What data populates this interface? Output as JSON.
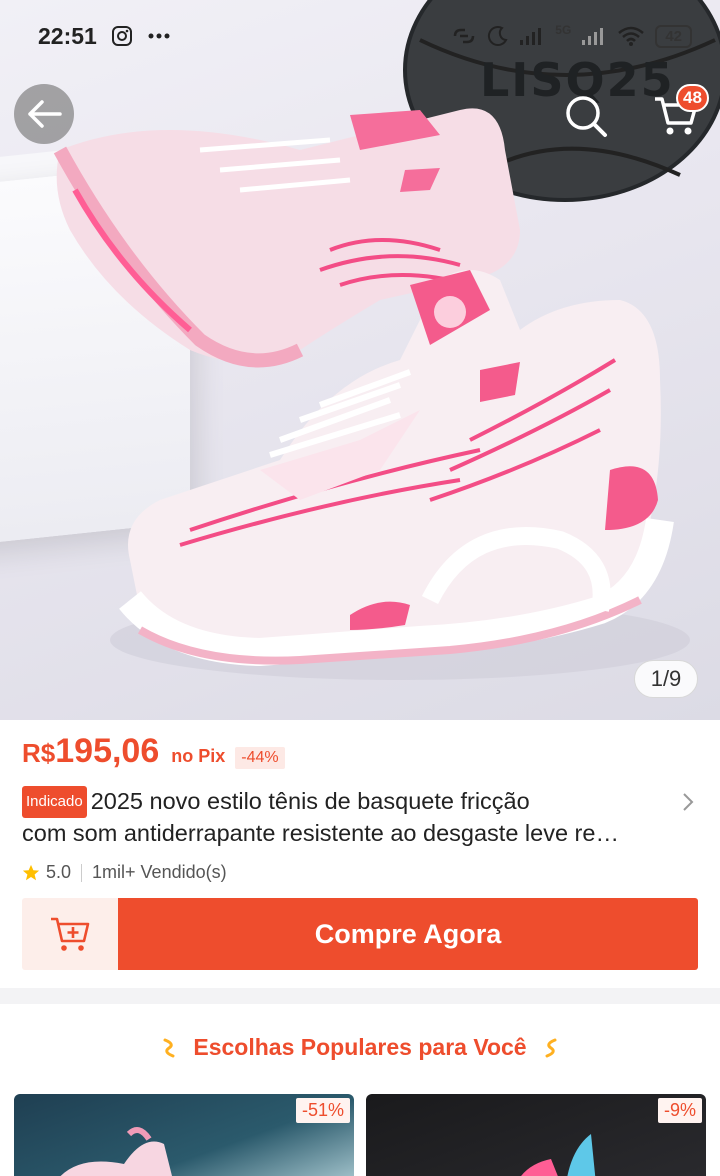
{
  "status_bar": {
    "time": "22:51",
    "network": "5G",
    "battery": "42",
    "icons": [
      "instagram-icon",
      "more-dots-icon",
      "link-icon",
      "moon-icon",
      "signal-icon",
      "wifi-icon",
      "battery-icon"
    ]
  },
  "header": {
    "back_icon": "arrow-left-icon",
    "search_icon": "search-icon",
    "cart_icon": "cart-icon",
    "cart_count": "48"
  },
  "gallery": {
    "counter": "1/9",
    "ball_text": "LISQ25"
  },
  "product": {
    "currency": "R$",
    "price": "195,06",
    "price_note": "no Pix",
    "discount": "-44%",
    "tag": "Indicado",
    "title_line1": "2025 novo estilo tênis de basquete fricção",
    "title_line2": "com som antiderrapante resistente ao desgaste leve re…",
    "rating": "5.0",
    "sold": "1mil+ Vendido(s)"
  },
  "actions": {
    "add_to_cart_icon": "cart-plus-icon",
    "buy_now_label": "Compre Agora"
  },
  "popular": {
    "heading": "Escolhas Populares para Você",
    "items": [
      {
        "discount": "-51%"
      },
      {
        "discount": "-9%"
      }
    ]
  },
  "colors": {
    "accent": "#ee4d2d",
    "accent_light": "#fdeeea",
    "shoe_pink": "#f45b8c"
  }
}
